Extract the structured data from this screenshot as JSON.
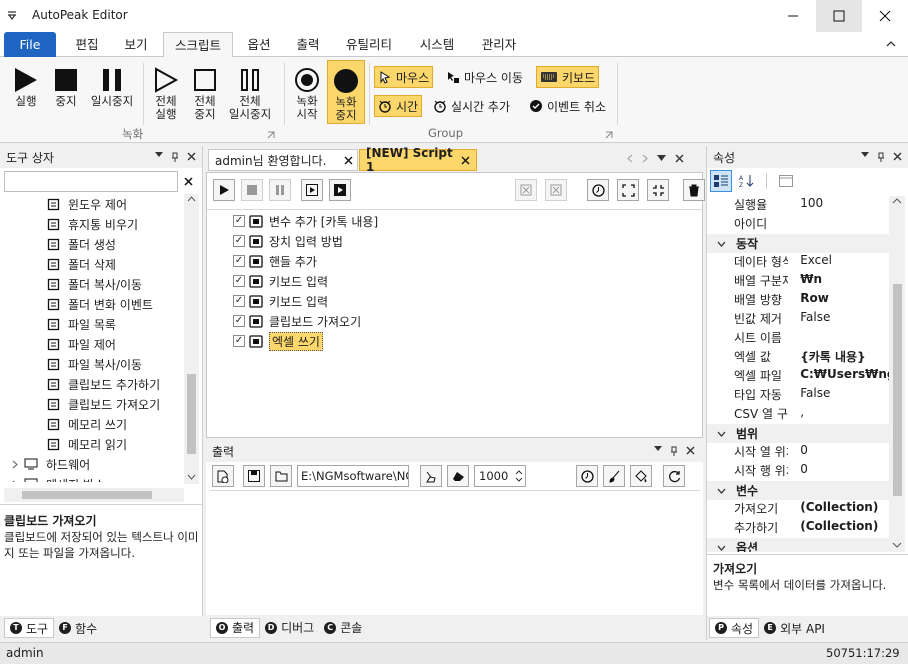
{
  "app": {
    "title": "AutoPeak Editor"
  },
  "menu": [
    "File",
    "편집",
    "보기",
    "스크립트",
    "옵션",
    "출력",
    "유틸리티",
    "시스템",
    "관리자"
  ],
  "ribbon": {
    "record_buttons": [
      "실행",
      "중지",
      "일시중지"
    ],
    "all_buttons": [
      [
        "전체",
        "실행"
      ],
      [
        "전체",
        "중지"
      ],
      [
        "전체",
        "일시중지"
      ]
    ],
    "record_group_label": "녹화",
    "rec_start": [
      "녹화",
      "시작"
    ],
    "rec_stop": [
      "녹화",
      "중지"
    ],
    "options": {
      "mouse": "마우스",
      "mouse_move": "마우스 이동",
      "keyboard": "키보드",
      "time": "시간",
      "realtime": "실시간 추가",
      "cancel_event": "이벤트 취소"
    },
    "group_label": "Group"
  },
  "toolbox": {
    "title": "도구 상자",
    "items": [
      "윈도우 제어",
      "휴지통 비우기",
      "폴더 생성",
      "폴더 삭제",
      "폴더 복사/이동",
      "폴더 변화 이벤트",
      "파일 목록",
      "파일 제어",
      "파일 복사/이동",
      "클립보드 추가하기",
      "클립보드 가져오기",
      "메모리 쓰기",
      "메모리 읽기"
    ],
    "groups": [
      "하드웨어",
      "메세지 박스"
    ],
    "desc_title": "클립보드 가져오기",
    "desc": "클립보드에 저장되어 있는 텍스트나 이미지 또는 파일을 가져옵니다.",
    "tabs": [
      {
        "letter": "T",
        "label": "도구"
      },
      {
        "letter": "F",
        "label": "함수"
      }
    ]
  },
  "editor": {
    "tabs": [
      "admin님 환영합니다.",
      "[NEW] Script 1"
    ],
    "steps": [
      "변수 추가 [카톡 내용]",
      "장치 입력 방법",
      "핸들 추가",
      "키보드 입력",
      "키보드 입력",
      "클립보드 가져오기",
      "엑셀 쓰기"
    ]
  },
  "output": {
    "title": "출력",
    "path": "E:\\NGMsoftware\\NG",
    "count": "1000",
    "tabs": [
      {
        "letter": "O",
        "label": "출력"
      },
      {
        "letter": "D",
        "label": "디버그"
      },
      {
        "letter": "C",
        "label": "콘솔"
      }
    ]
  },
  "properties": {
    "title": "속성",
    "top_rows": [
      {
        "k": "실행율",
        "v": "100"
      },
      {
        "k": "아이디",
        "v": ""
      }
    ],
    "cat1": "동작",
    "rows1": [
      {
        "k": "데이타 형식",
        "v": "Excel",
        "b": false
      },
      {
        "k": "배열 구분자",
        "v": "₩n",
        "b": true
      },
      {
        "k": "배열 방향",
        "v": "Row",
        "b": true
      },
      {
        "k": "빈값 제거",
        "v": "False",
        "b": false
      },
      {
        "k": "시트 이름",
        "v": "",
        "b": false
      },
      {
        "k": "엑셀 값",
        "v": "{카톡 내용}",
        "b": true
      },
      {
        "k": "엑셀 파일",
        "v": "C:₩Users₩ngma",
        "b": true
      },
      {
        "k": "타입 자동",
        "v": "False",
        "b": false
      },
      {
        "k": "CSV 열 구분",
        "v": ",",
        "b": false
      }
    ],
    "cat2": "범위",
    "rows2": [
      {
        "k": "시작 열 위치",
        "v": "0"
      },
      {
        "k": "시작 행 위치",
        "v": "0"
      }
    ],
    "cat3": "변수",
    "rows3": [
      {
        "k": "가져오기",
        "v": "(Collection)"
      },
      {
        "k": "추가하기",
        "v": "(Collection)"
      }
    ],
    "cat4": "옵션",
    "desc_title": "가져오기",
    "desc": "변수 목록에서 데이터를 가져옵니다.",
    "tabs": [
      {
        "letter": "P",
        "label": "속성"
      },
      {
        "letter": "E",
        "label": "외부 API"
      }
    ]
  },
  "status": {
    "user": "admin",
    "time": "50751:17:29"
  },
  "colors": {
    "accent": "#1e65c2",
    "highlight": "#fbd66b",
    "editor_tab": "#fcd86c"
  }
}
